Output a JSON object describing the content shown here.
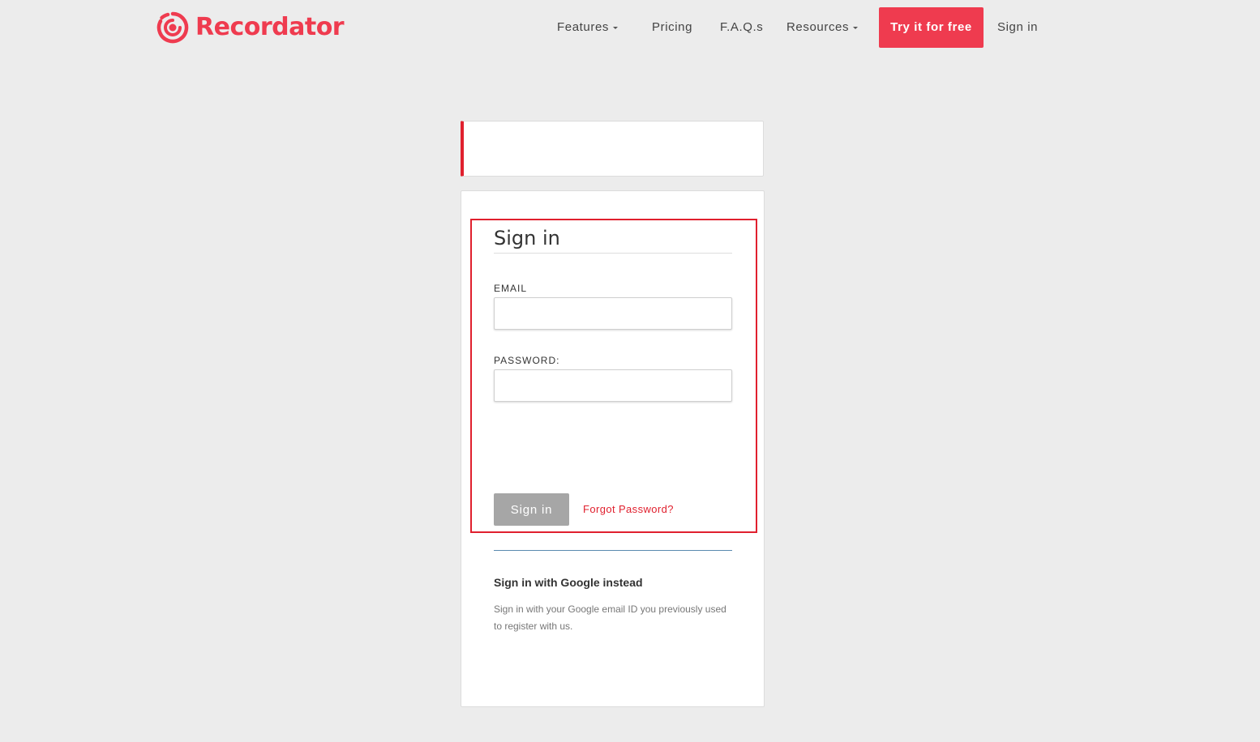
{
  "colors": {
    "brand": "#ef3b4f",
    "background": "#ececec",
    "card": "#ffffff",
    "highlight": "#e0202e",
    "disabled_button": "#a6a6a6",
    "divider": "#5a8ab0"
  },
  "header": {
    "logo_icon": "recordator-logo-icon",
    "logo_text": "Recordator",
    "nav": {
      "features": "Features",
      "pricing": "Pricing",
      "faqs": "F.A.Q.s",
      "resources": "Resources",
      "try_free": "Try it for free",
      "sign_in": "Sign in"
    }
  },
  "form": {
    "title": "Sign in",
    "email_label": "EMAIL",
    "email_value": "",
    "password_label": "PASSWORD:",
    "password_value": "",
    "submit_label": "Sign in",
    "forgot_label": "Forgot Password?"
  },
  "google": {
    "title": "Sign in with Google instead",
    "description": "Sign in with your Google email ID you previously used to register with us."
  }
}
